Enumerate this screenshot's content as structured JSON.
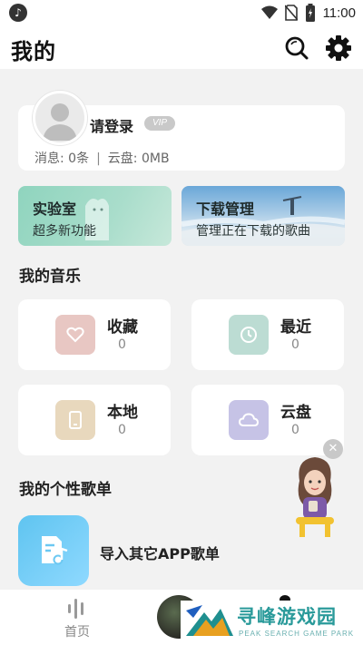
{
  "status_bar": {
    "time": "11:00",
    "icons": [
      "music-note-icon",
      "wifi-icon",
      "no-sim-icon",
      "battery-charging-icon"
    ]
  },
  "header": {
    "title": "我的",
    "search_icon": "search-icon",
    "settings_icon": "gear-icon"
  },
  "profile": {
    "login_label": "请登录",
    "vip_label": "VIP",
    "messages": "消息: 0条",
    "cloud": "云盘: 0MB",
    "separator": "|"
  },
  "promo_cards": [
    {
      "title": "实验室",
      "subtitle": "超多新功能"
    },
    {
      "title": "下载管理",
      "subtitle": "管理正在下载的歌曲"
    }
  ],
  "my_music": {
    "section_title": "我的音乐",
    "tiles": [
      {
        "name": "收藏",
        "count": "0",
        "icon": "heart-icon",
        "color": "#e8c7c3"
      },
      {
        "name": "最近",
        "count": "0",
        "icon": "clock-icon",
        "color": "#bcdcd3"
      },
      {
        "name": "本地",
        "count": "0",
        "icon": "phone-icon",
        "color": "#e8d8bd"
      },
      {
        "name": "云盘",
        "count": "0",
        "icon": "cloud-icon",
        "color": "#c6c3e6"
      }
    ]
  },
  "playlists": {
    "section_title": "我的个性歌单",
    "import_label": "导入其它APP歌单"
  },
  "bottom_nav": {
    "home_label": "首页"
  },
  "watermark": {
    "name": "寻峰游戏园",
    "subtitle": "PEAK SEARCH GAME PARK"
  },
  "float_close": "✕"
}
